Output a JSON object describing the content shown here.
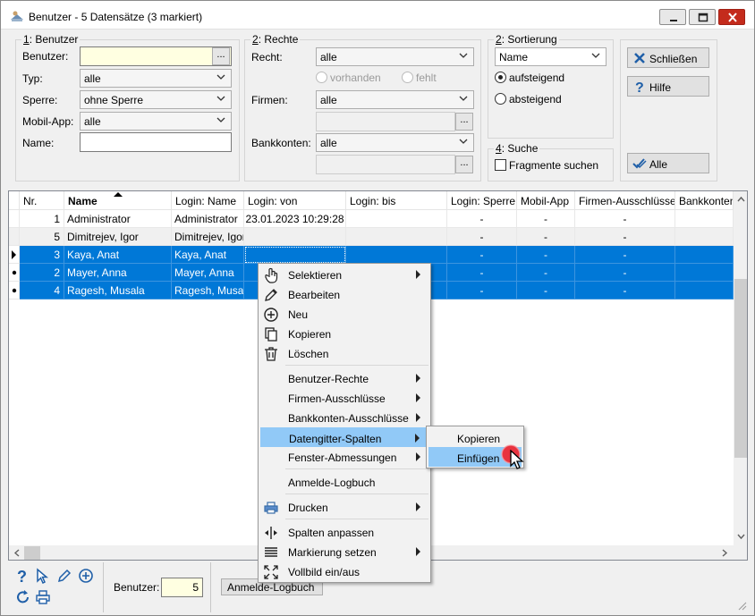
{
  "window": {
    "title": "Benutzer - 5 Datensätze (3 markiert)"
  },
  "group_benutzer": {
    "legend_num": "1",
    "legend_text": ": Benutzer",
    "benutzer_label": "Benutzer:",
    "benutzer_value": "",
    "typ_label": "Typ:",
    "typ_value": "alle",
    "sperre_label": "Sperre:",
    "sperre_value": "ohne Sperre",
    "mobil_label": "Mobil-App:",
    "mobil_value": "alle",
    "name_label": "Name:",
    "name_value": ""
  },
  "group_rechte": {
    "legend_num": "2",
    "legend_text": ": Rechte",
    "recht_label": "Recht:",
    "recht_value": "alle",
    "radio_vorhanden": "vorhanden",
    "radio_fehlt": "fehlt",
    "firmen_label": "Firmen:",
    "firmen_value": "alle",
    "bankkonten_label": "Bankkonten:",
    "bankkonten_value": "alle"
  },
  "group_sortierung": {
    "legend_num": "2",
    "legend_text": ": Sortierung",
    "sort_value": "Name",
    "radio_auf": "aufsteigend",
    "radio_ab": "absteigend"
  },
  "group_suche": {
    "legend_num": "4",
    "legend_text": ": Suche",
    "check_label": "Fragmente suchen"
  },
  "buttons": {
    "dots": "...",
    "schliessen": "Schließen",
    "hilfe": "Hilfe",
    "alle": "Alle"
  },
  "grid": {
    "columns": [
      "Nr.",
      "Name",
      "Login: Name",
      "Login: von",
      "Login: bis",
      "Login: Sperre",
      "Mobil-App",
      "Firmen-Ausschlüsse",
      "Bankkonten"
    ],
    "rows": [
      {
        "nr": "1",
        "name": "Administrator",
        "login_name": "Administrator",
        "login_von": "23.01.2023 10:29:28",
        "login_bis": "",
        "sperre": "-",
        "mobil": "-",
        "firmen": "-",
        "bank": "",
        "indicator": "",
        "state": "normal"
      },
      {
        "nr": "5",
        "name": "Dimitrejev, Igor",
        "login_name": "Dimitrejev, Igor",
        "login_von": "",
        "login_bis": "",
        "sperre": "-",
        "mobil": "-",
        "firmen": "-",
        "bank": "",
        "indicator": "",
        "state": "alt"
      },
      {
        "nr": "3",
        "name": "Kaya, Anat",
        "login_name": "Kaya, Anat",
        "login_von": "",
        "login_bis": "",
        "sperre": "-",
        "mobil": "-",
        "firmen": "-",
        "bank": "",
        "indicator": "arrow",
        "state": "sel"
      },
      {
        "nr": "2",
        "name": "Mayer, Anna",
        "login_name": "Mayer, Anna",
        "login_von": "",
        "login_bis": "",
        "sperre": "-",
        "mobil": "-",
        "firmen": "-",
        "bank": "",
        "indicator": "dot",
        "state": "sel"
      },
      {
        "nr": "4",
        "name": "Ragesh, Musala",
        "login_name": "Ragesh, Musal",
        "login_von": "",
        "login_bis": "",
        "sperre": "-",
        "mobil": "-",
        "firmen": "-",
        "bank": "",
        "indicator": "dot",
        "state": "sel"
      }
    ]
  },
  "bottom": {
    "benutzer_label": "Benutzer:",
    "benutzer_count": "5",
    "logbuch_button": "Anmelde-Logbuch"
  },
  "context_menu": {
    "items": [
      {
        "label": "Selektieren",
        "icon": "hand-pointer-icon",
        "submenu": true
      },
      {
        "label": "Bearbeiten",
        "icon": "pencil-icon",
        "submenu": false
      },
      {
        "label": "Neu",
        "icon": "plus-circle-icon",
        "submenu": false
      },
      {
        "label": "Kopieren",
        "icon": "copy-icon",
        "submenu": false
      },
      {
        "label": "Löschen",
        "icon": "trash-icon",
        "submenu": false
      },
      {
        "label": "Benutzer-Rechte",
        "icon": "",
        "submenu": true
      },
      {
        "label": "Firmen-Ausschlüsse",
        "icon": "",
        "submenu": true
      },
      {
        "label": "Bankkonten-Ausschlüsse",
        "icon": "",
        "submenu": true
      },
      {
        "label": "Datengitter-Spalten",
        "icon": "",
        "submenu": true
      },
      {
        "label": "Fenster-Abmessungen",
        "icon": "",
        "submenu": true
      },
      {
        "label": "Anmelde-Logbuch",
        "icon": "",
        "submenu": false
      },
      {
        "label": "Drucken",
        "icon": "printer-icon",
        "submenu": true
      },
      {
        "label": "Spalten anpassen",
        "icon": "column-resize-icon",
        "submenu": false
      },
      {
        "label": "Markierung setzen",
        "icon": "lines-icon",
        "submenu": true
      },
      {
        "label": "Vollbild ein/aus",
        "icon": "fullscreen-icon",
        "submenu": false
      }
    ]
  },
  "submenu": {
    "items": [
      {
        "label": "Kopieren"
      },
      {
        "label": "Einfügen"
      }
    ]
  },
  "colors": {
    "selection": "#0078d7",
    "menu_highlight": "#91c9f7",
    "close_button": "#c42b1c",
    "click_marker": "#e8333f"
  }
}
